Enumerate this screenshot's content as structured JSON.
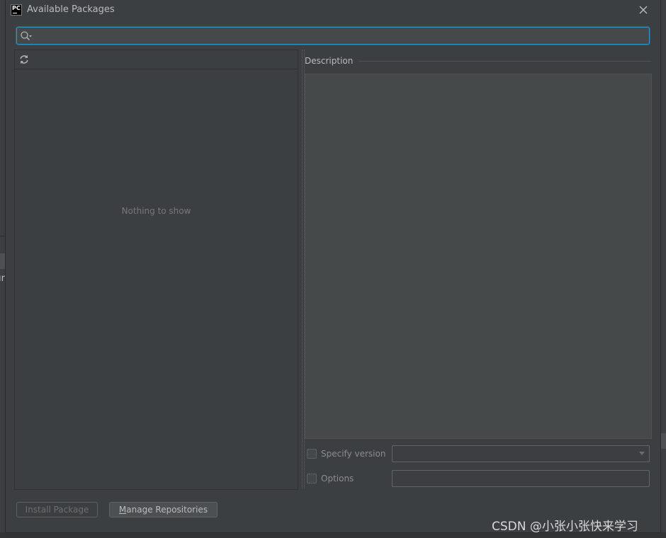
{
  "dialog": {
    "title": "Available Packages",
    "app_icon": "pycharm-icon",
    "close_icon": "close-icon"
  },
  "search": {
    "value": "",
    "placeholder": "",
    "icon": "search-icon"
  },
  "packages": {
    "refresh_icon": "refresh-icon",
    "empty_text": "Nothing to show"
  },
  "details": {
    "description_label": "Description",
    "description_text": "",
    "specify_version": {
      "label": "Specify version",
      "checked": false,
      "selected_value": ""
    },
    "options": {
      "label": "Options",
      "checked": false,
      "value": ""
    }
  },
  "buttons": {
    "install": "Install Package",
    "manage_mnemonic": "M",
    "manage_rest": "anage Repositories"
  },
  "watermark": "CSDN @小张小张快来学习",
  "colors": {
    "dialog_bg": "#3c3f41",
    "field_bg": "#45494a",
    "focus_border": "#3592c4",
    "text": "#bbbbbb",
    "muted_text": "#787878"
  }
}
